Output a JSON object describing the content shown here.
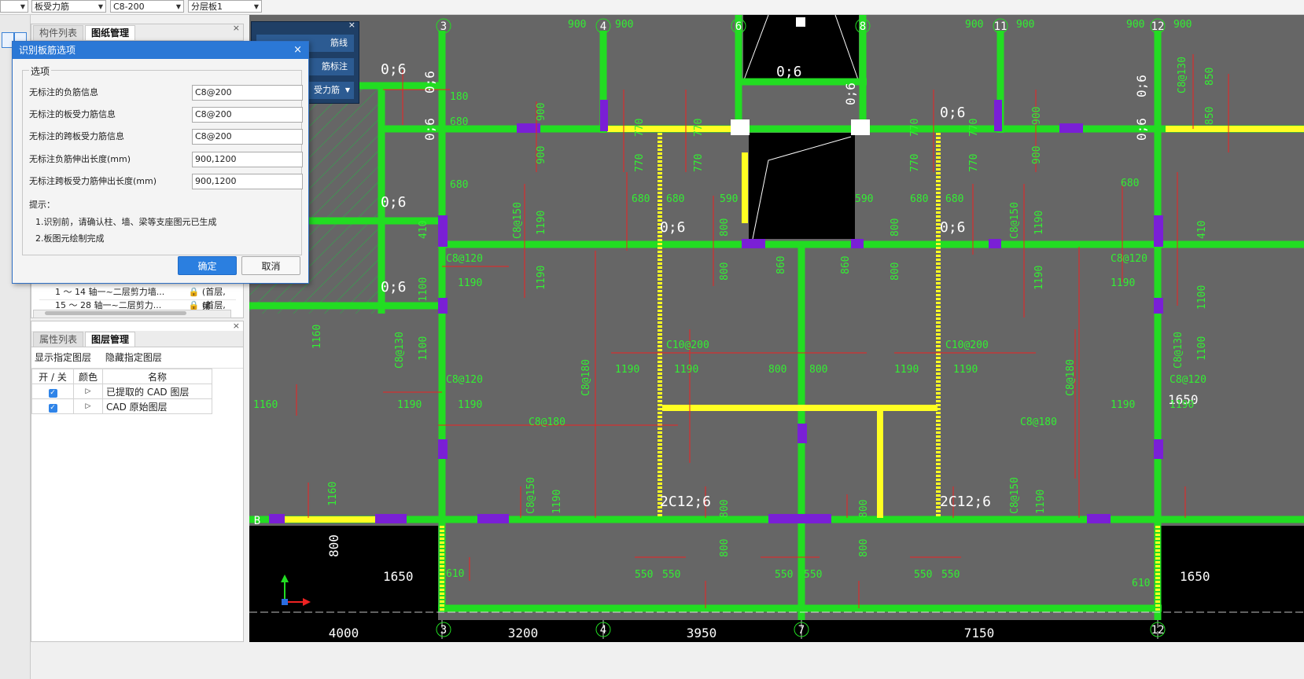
{
  "toolbar": {
    "combo1": "板受力筋",
    "combo2": "C8-200",
    "combo3": "分层板1"
  },
  "upper_panel": {
    "tabs": [
      "构件列表",
      "图纸管理"
    ],
    "rows": [
      {
        "name": "1 ～ 14 轴一~二层剪力墙...",
        "floor": "(首层,第:"
      },
      {
        "name": "15 ～ 28 轴一~二层剪力...",
        "floor": "(首层,第:"
      }
    ]
  },
  "floatbar": {
    "items": [
      "筋线",
      "筋标注",
      "受力筋"
    ]
  },
  "layer_panel": {
    "tabs": [
      "属性列表",
      "图层管理"
    ],
    "show_btn": "显示指定图层",
    "hide_btn": "隐藏指定图层",
    "headers": [
      "开 / 关",
      "颜色",
      "名称"
    ],
    "layers": [
      {
        "name": "已提取的 CAD 图层"
      },
      {
        "name": "CAD 原始图层"
      }
    ]
  },
  "dialog": {
    "title": "识别板筋选项",
    "group_label": "选项",
    "fields": [
      {
        "label": "无标注的负筋信息",
        "value": "C8@200"
      },
      {
        "label": "无标注的板受力筋信息",
        "value": "C8@200"
      },
      {
        "label": "无标注的跨板受力筋信息",
        "value": "C8@200"
      },
      {
        "label": "无标注负筋伸出长度(mm)",
        "value": "900,1200"
      },
      {
        "label": "无标注跨板受力筋伸出长度(mm)",
        "value": "900,1200"
      }
    ],
    "tip_title": "提示：",
    "tips": [
      "1.识别前，请确认柱、墙、梁等支座图元已生成",
      "2.板图元绘制完成"
    ],
    "ok": "确定",
    "cancel": "取消"
  },
  "cad": {
    "axis_labels": [
      "3",
      "4",
      "6",
      "8",
      "11",
      "12",
      "7",
      "B"
    ],
    "bottom_dims": [
      "4000",
      "3200",
      "3950",
      "7150"
    ],
    "texts": {
      "rebar_06": "0;6",
      "c8_120": "C8@120",
      "c8_180": "C8@180",
      "c8_150": "C8@150",
      "c8_130": "C8@130",
      "c10_200": "C10@200",
      "c12": "2C12;6",
      "d900": "900",
      "d680": "680",
      "d770": "770",
      "d1190": "1190",
      "d1160": "1160",
      "d800": "800",
      "d860": "860",
      "d550": "550",
      "d590": "590",
      "d610": "610",
      "d1650": "1650",
      "d1100": "1100",
      "d850": "850",
      "d410": "410",
      "d180": "180"
    },
    "colors": {
      "bg": "#666666",
      "beam": "#22dd22",
      "rebar": "#ee2222",
      "text": "#33ee33",
      "yellow": "#ffff22",
      "purple": "#7a1fd6",
      "hatch": "#2fa84a"
    }
  }
}
